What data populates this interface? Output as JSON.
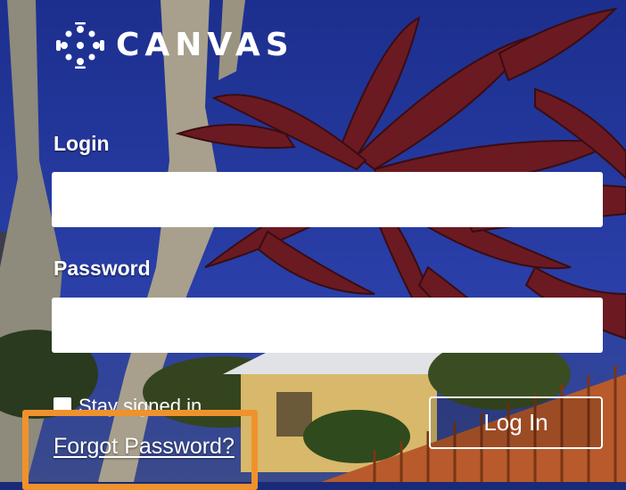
{
  "brand": {
    "name": "CANVAS",
    "logo_icon": "canvas-logo-icon"
  },
  "login": {
    "label": "Login",
    "value": "",
    "placeholder": ""
  },
  "password": {
    "label": "Password",
    "value": "",
    "placeholder": ""
  },
  "remember": {
    "label": "Stay signed in",
    "checked": false
  },
  "actions": {
    "login_button": "Log In",
    "forgot_link": "Forgot Password?"
  },
  "annotation": {
    "highlight_color": "#f0922b",
    "target": "Forgot Password?"
  },
  "colors": {
    "sky": "#1f3398",
    "foliage": "#6b1a22",
    "trunk": "#a49c88",
    "house": "#d8b86a",
    "fence": "#b85a2c"
  }
}
